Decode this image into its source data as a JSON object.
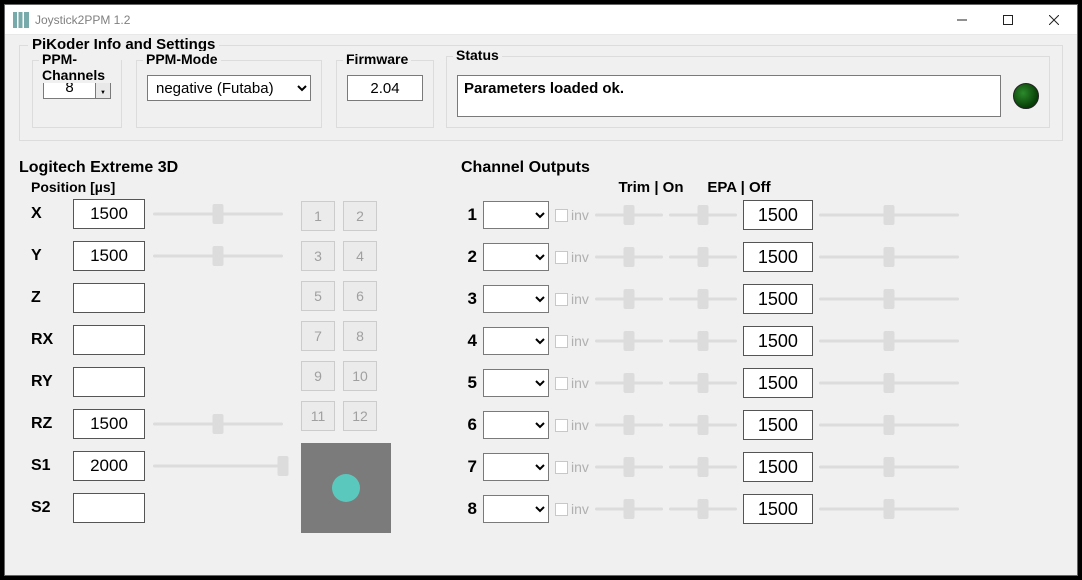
{
  "window": {
    "title": "Joystick2PPM 1.2"
  },
  "settings": {
    "group_label": "PiKoder Info and Settings",
    "channels_label": "PPM-Channels",
    "channels_value": "8",
    "mode_label": "PPM-Mode",
    "mode_value": "negative (Futaba)",
    "firmware_label": "Firmware",
    "firmware_value": "2.04"
  },
  "status": {
    "label": "Status",
    "text": "Parameters loaded ok."
  },
  "joystick": {
    "title": "Logitech Extreme 3D",
    "position_label": "Position [µs]",
    "axes": [
      {
        "name": "X",
        "value": "1500",
        "pos": 50,
        "has_slider": true
      },
      {
        "name": "Y",
        "value": "1500",
        "pos": 50,
        "has_slider": true
      },
      {
        "name": "Z",
        "value": "",
        "pos": null,
        "has_slider": false
      },
      {
        "name": "RX",
        "value": "",
        "pos": null,
        "has_slider": false
      },
      {
        "name": "RY",
        "value": "",
        "pos": null,
        "has_slider": false
      },
      {
        "name": "RZ",
        "value": "1500",
        "pos": 50,
        "has_slider": true
      },
      {
        "name": "S1",
        "value": "2000",
        "pos": 100,
        "has_slider": true
      },
      {
        "name": "S2",
        "value": "",
        "pos": null,
        "has_slider": false
      }
    ],
    "buttons": [
      "1",
      "2",
      "3",
      "4",
      "5",
      "6",
      "7",
      "8",
      "9",
      "10",
      "11",
      "12"
    ]
  },
  "channels": {
    "title": "Channel Outputs",
    "header_trim": "Trim | On",
    "header_epa": "EPA | Off",
    "inv_label": "inv",
    "rows": [
      {
        "num": "1",
        "value": "1500"
      },
      {
        "num": "2",
        "value": "1500"
      },
      {
        "num": "3",
        "value": "1500"
      },
      {
        "num": "4",
        "value": "1500"
      },
      {
        "num": "5",
        "value": "1500"
      },
      {
        "num": "6",
        "value": "1500"
      },
      {
        "num": "7",
        "value": "1500"
      },
      {
        "num": "8",
        "value": "1500"
      }
    ]
  }
}
